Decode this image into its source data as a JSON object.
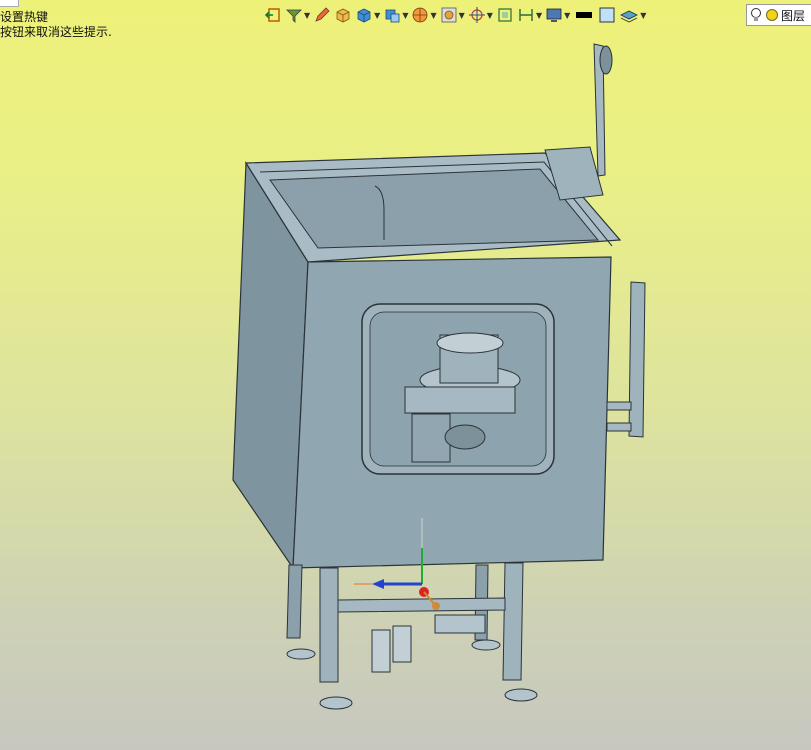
{
  "hint": {
    "line1": "设置热键",
    "line2": "按钮来取消这些提示."
  },
  "toolbar": {
    "icons": [
      "exit-sketch-icon",
      "filter-icon",
      "edit-icon",
      "solid-icon",
      "box-view-icon",
      "cube-display-icon",
      "section-view-icon",
      "render-icon",
      "zoom-icon",
      "center-icon",
      "fit-icon",
      "measure-icon",
      "screen-icon",
      "black-swatch-icon",
      "blue-swatch-icon",
      "layers-stack-icon"
    ]
  },
  "layer_button": {
    "label": "图层"
  },
  "colors": {
    "background_top": "#eef178",
    "background_bottom": "#c7c7c0",
    "model_fill": "#8fa6b0",
    "model_edge": "#2a3338"
  }
}
